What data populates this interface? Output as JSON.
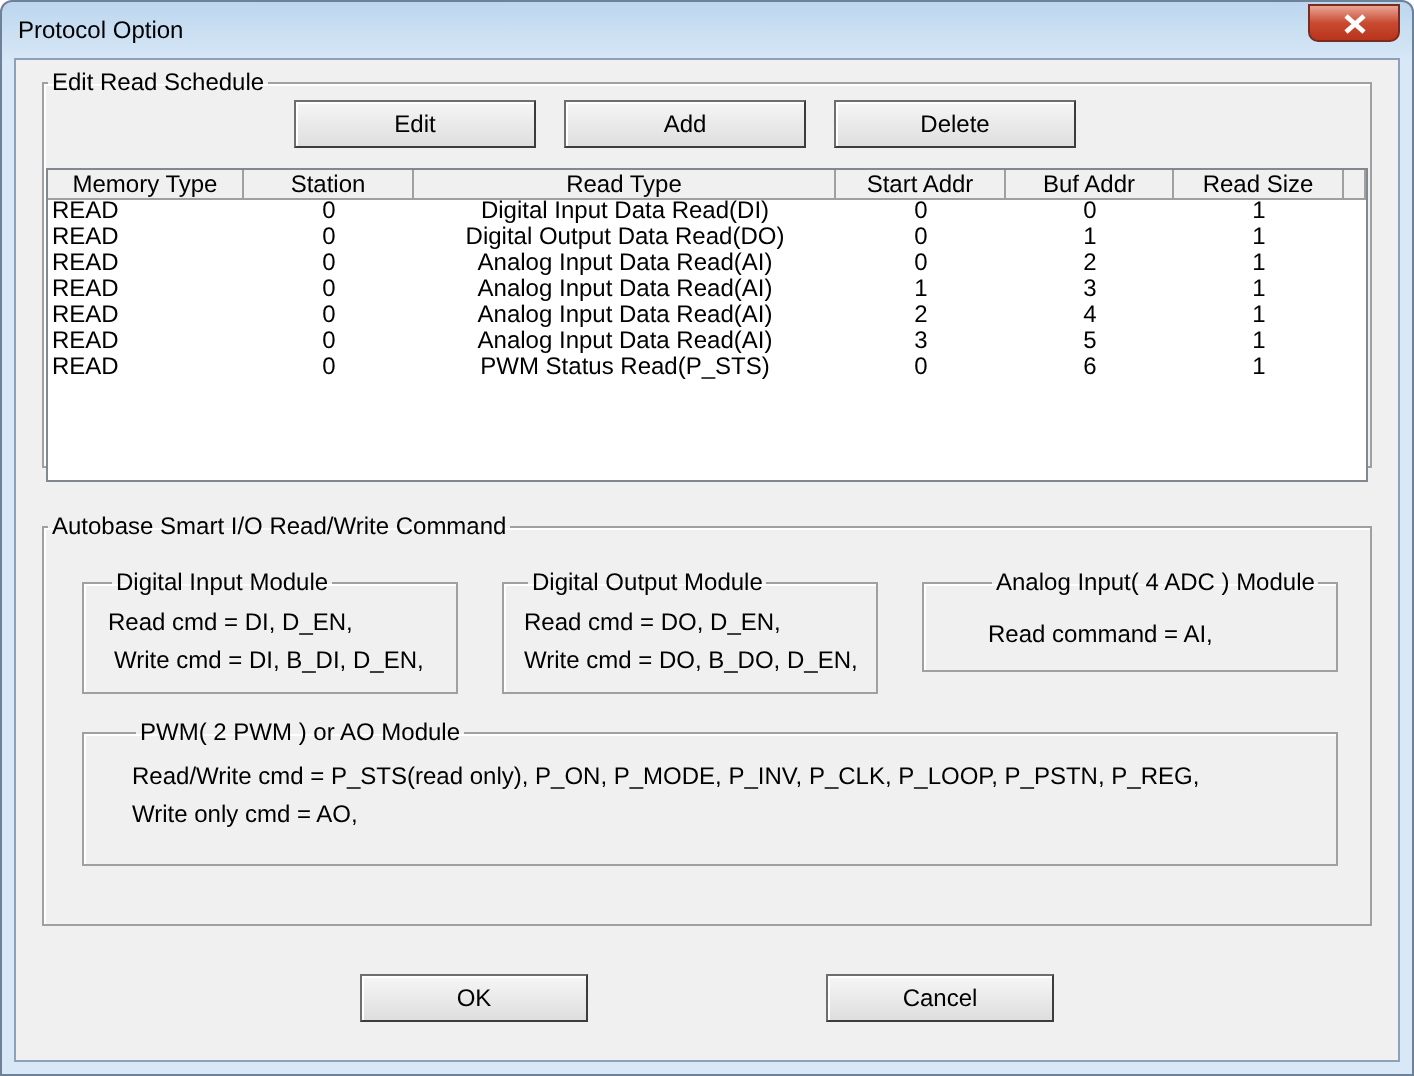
{
  "window": {
    "title": "Protocol Option"
  },
  "schedule": {
    "title": "Edit Read Schedule",
    "buttons": [
      "Edit",
      "Add",
      "Delete"
    ],
    "columns": [
      "Memory Type",
      "Station",
      "Read Type",
      "Start Addr",
      "Buf Addr",
      "Read Size"
    ],
    "rows": [
      [
        "READ",
        "0",
        "Digital Input Data Read(DI)",
        "0",
        "0",
        "1"
      ],
      [
        "READ",
        "0",
        "Digital Output Data Read(DO)",
        "0",
        "1",
        "1"
      ],
      [
        "READ",
        "0",
        "Analog Input Data Read(AI)",
        "0",
        "2",
        "1"
      ],
      [
        "READ",
        "0",
        "Analog Input Data Read(AI)",
        "1",
        "3",
        "1"
      ],
      [
        "READ",
        "0",
        "Analog Input Data Read(AI)",
        "2",
        "4",
        "1"
      ],
      [
        "READ",
        "0",
        "Analog Input Data Read(AI)",
        "3",
        "5",
        "1"
      ],
      [
        "READ",
        "0",
        "PWM Status Read(P_STS)",
        "0",
        "6",
        "1"
      ]
    ]
  },
  "commands": {
    "title": "Autobase Smart I/O Read/Write Command",
    "modules": [
      {
        "title": "Digital Input Module",
        "lines": [
          "Read cmd = DI, D_EN,",
          "Write cmd = DI, B_DI, D_EN,"
        ]
      },
      {
        "title": "Digital Output Module",
        "lines": [
          "Read cmd = DO, D_EN,",
          "Write cmd = DO, B_DO, D_EN,"
        ]
      },
      {
        "title": "Analog Input( 4 ADC ) Module",
        "lines": [
          "Read command = AI,"
        ]
      }
    ],
    "pwm": {
      "title": "PWM( 2 PWM ) or AO Module",
      "lines": [
        "Read/Write cmd = P_STS(read only), P_ON, P_MODE, P_INV, P_CLK, P_LOOP,  P_PSTN, P_REG,",
        "Write only cmd = AO,"
      ]
    }
  },
  "buttons": [
    "OK",
    "Cancel"
  ]
}
